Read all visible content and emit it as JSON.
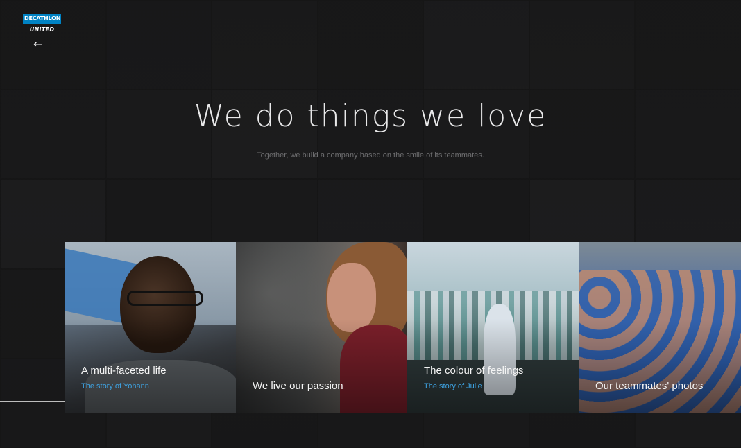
{
  "brand": {
    "logo_text": "DECATHLON",
    "sub_text": "UNITED"
  },
  "nav": {
    "back_symbol": "←",
    "back_icon": "arrow-left-icon"
  },
  "hero": {
    "title": "We do things we love",
    "subtitle": "Together, we build a company based on the smile of its teammates."
  },
  "cards": [
    {
      "title": "A multi-faceted life",
      "link": "The story of Yohann"
    },
    {
      "title": "We live our passion",
      "link": ""
    },
    {
      "title": "The colour of feelings",
      "link": "The story of Julie"
    },
    {
      "title": "Our teammates' photos",
      "link": ""
    }
  ],
  "colors": {
    "brand_blue": "#0082c3",
    "link_blue": "#3ea3e3",
    "background": "#1a1a1b"
  }
}
